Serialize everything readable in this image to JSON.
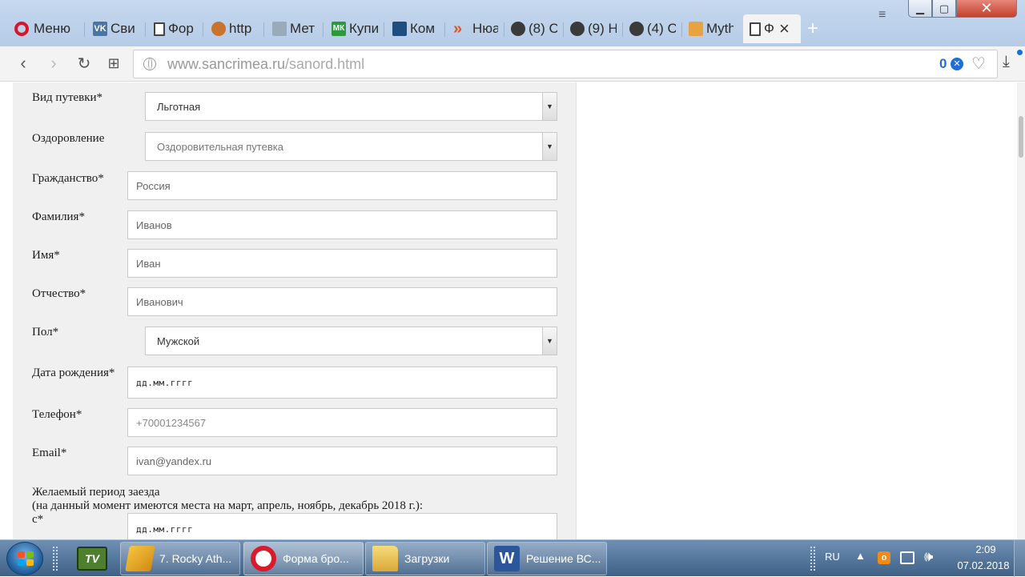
{
  "browser": {
    "menu_label": "Меню",
    "tabs": [
      {
        "label": "Сви",
        "icon": "vk-icon"
      },
      {
        "label": "Фор",
        "icon": "document-icon"
      },
      {
        "label": "http",
        "icon": "emblem-icon"
      },
      {
        "label": "Мет",
        "icon": "weather-icon"
      },
      {
        "label": "Купи",
        "icon": "mk-icon"
      },
      {
        "label": "Ком",
        "icon": "blue-square-icon"
      },
      {
        "label": "Нюа",
        "icon": "double-chevron-icon"
      },
      {
        "label": "(8) С",
        "icon": "avatar-icon"
      },
      {
        "label": "(9) Н",
        "icon": "avatar-icon"
      },
      {
        "label": "(4) С",
        "icon": "avatar-icon"
      },
      {
        "label": "Myth",
        "icon": "app-icon"
      },
      {
        "label": "Ф",
        "icon": "document-icon",
        "active": true
      }
    ],
    "address": {
      "host": "www.sancrimea.ru",
      "path": "/sanord.html",
      "adblock_count": "0"
    }
  },
  "form": {
    "fields": [
      {
        "label": "Вид путевки*",
        "value": "Льготная",
        "type": "select"
      },
      {
        "label": "Оздоровление",
        "value": "Оздоровительная путевка",
        "type": "select"
      },
      {
        "label": "Гражданство*",
        "value": "Россия",
        "type": "text"
      },
      {
        "label": "Фамилия*",
        "value": "Иванов",
        "type": "text"
      },
      {
        "label": "Имя*",
        "value": "Иван",
        "type": "text"
      },
      {
        "label": "Отчество*",
        "value": "Иванович",
        "type": "text"
      },
      {
        "label": "Пол*",
        "value": "Мужской",
        "type": "select"
      },
      {
        "label": "Дата рождения*",
        "value": "дд.мм.гггг",
        "type": "date"
      },
      {
        "label": "Телефон*",
        "value": "+70001234567",
        "type": "text"
      },
      {
        "label": "Email*",
        "value": "ivan@yandex.ru",
        "type": "text"
      }
    ],
    "period": {
      "line1": "Желаемый период заезда",
      "line2": "(на данный момент имеются места на март, апрель, ноябрь, декабрь 2018 г.):",
      "from_label": "с*",
      "from_value": "дд.мм.гггг"
    }
  },
  "taskbar": {
    "buttons": [
      {
        "label": "7. Rocky Ath...",
        "icon": "aimp-icon"
      },
      {
        "label": "Форма бро...",
        "icon": "opera-icon",
        "active": true
      },
      {
        "label": "Загрузки",
        "icon": "folder-icon"
      },
      {
        "label": "Решение ВС...",
        "icon": "word-icon"
      }
    ],
    "tray": {
      "language": "RU",
      "time": "2:09",
      "date": "07.02.2018"
    }
  }
}
